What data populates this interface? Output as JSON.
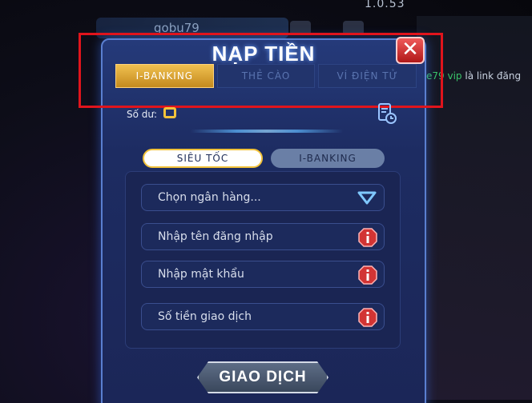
{
  "version": "1.0.53",
  "background": {
    "username": "gobu79",
    "chat_prefix": "e79 vip",
    "chat_text": "là link đăng"
  },
  "dialog": {
    "title": "NẠP TIỀN",
    "close_label": "✕",
    "tabs": [
      {
        "label": "I-BANKING",
        "active": true
      },
      {
        "label": "THẺ CÀO",
        "active": false
      },
      {
        "label": "VÍ ĐIỆN TỬ",
        "active": false
      }
    ],
    "balance_label": "Số dư:",
    "subtabs": [
      {
        "label": "SIÊU TỐC",
        "active": true
      },
      {
        "label": "I-BANKING",
        "active": false
      }
    ],
    "fields": {
      "bank_select": "Chọn ngân hàng...",
      "username": "Nhập tên đăng nhập",
      "password": "Nhập mật khẩu",
      "amount": "Số tiền giao dịch"
    },
    "submit_label": "GIAO DỊCH"
  },
  "colors": {
    "accent_gold": "#f2c23a",
    "highlight_red": "#e0141c",
    "panel_blue": "#1d2c62"
  }
}
